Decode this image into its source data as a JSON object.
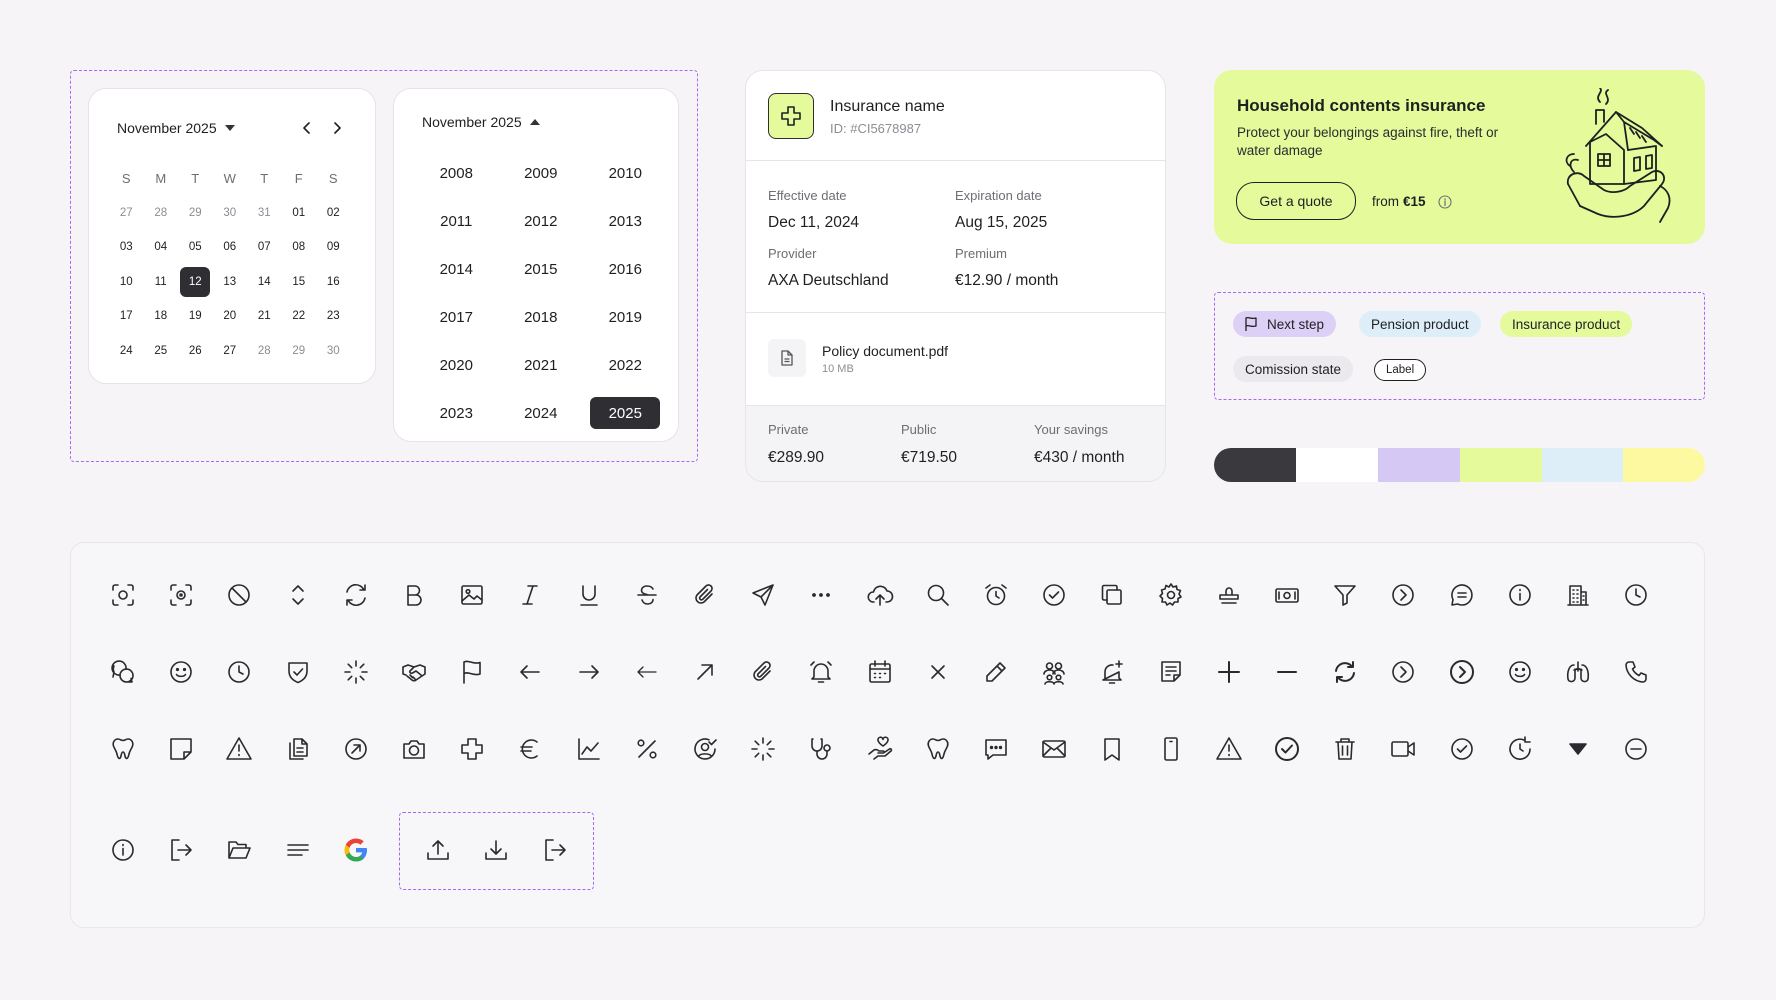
{
  "calendar": {
    "month_label": "November 2025",
    "weekdays": [
      "S",
      "M",
      "T",
      "W",
      "T",
      "F",
      "S"
    ],
    "days": [
      {
        "d": "27",
        "m": 1
      },
      {
        "d": "28",
        "m": 1
      },
      {
        "d": "29",
        "m": 1
      },
      {
        "d": "30",
        "m": 1
      },
      {
        "d": "31",
        "m": 1
      },
      {
        "d": "01",
        "m": 0
      },
      {
        "d": "02",
        "m": 0
      },
      {
        "d": "03",
        "m": 0
      },
      {
        "d": "04",
        "m": 0
      },
      {
        "d": "05",
        "m": 0
      },
      {
        "d": "06",
        "m": 0
      },
      {
        "d": "07",
        "m": 0
      },
      {
        "d": "08",
        "m": 0
      },
      {
        "d": "09",
        "m": 0
      },
      {
        "d": "10",
        "m": 0
      },
      {
        "d": "11",
        "m": 0
      },
      {
        "d": "12",
        "m": 0,
        "s": 1
      },
      {
        "d": "13",
        "m": 0
      },
      {
        "d": "14",
        "m": 0
      },
      {
        "d": "15",
        "m": 0
      },
      {
        "d": "16",
        "m": 0
      },
      {
        "d": "17",
        "m": 0
      },
      {
        "d": "18",
        "m": 0
      },
      {
        "d": "19",
        "m": 0
      },
      {
        "d": "20",
        "m": 0
      },
      {
        "d": "21",
        "m": 0
      },
      {
        "d": "22",
        "m": 0
      },
      {
        "d": "23",
        "m": 0
      },
      {
        "d": "24",
        "m": 0
      },
      {
        "d": "25",
        "m": 0
      },
      {
        "d": "26",
        "m": 0
      },
      {
        "d": "27",
        "m": 0
      },
      {
        "d": "28",
        "m": 1
      },
      {
        "d": "29",
        "m": 1
      },
      {
        "d": "30",
        "m": 1
      }
    ]
  },
  "year_picker": {
    "month_label": "November 2025",
    "years": [
      "2008",
      "2009",
      "2010",
      "2011",
      "2012",
      "2013",
      "2014",
      "2015",
      "2016",
      "2017",
      "2018",
      "2019",
      "2020",
      "2021",
      "2022",
      "2023",
      "2024",
      "2025"
    ],
    "selected": "2025"
  },
  "insurance": {
    "name": "Insurance name",
    "id": "ID: #CI5678987",
    "effective_label": "Effective date",
    "effective_value": "Dec 11, 2024",
    "expiration_label": "Expiration date",
    "expiration_value": "Aug 15, 2025",
    "provider_label": "Provider",
    "provider_value": "AXA Deutschland",
    "premium_label": "Premium",
    "premium_value": "€12.90 / month",
    "doc_name": "Policy document.pdf",
    "doc_size": "10 MB",
    "private_label": "Private",
    "private_value": "€289.90",
    "public_label": "Public",
    "public_value": "€719.50",
    "savings_label": "Your savings",
    "savings_value": "€430 / month"
  },
  "promo": {
    "title": "Household contents insurance",
    "description": "Protect your belongings against fire, theft or water damage",
    "cta": "Get a quote",
    "from_label": "from",
    "from_price": "€15"
  },
  "chips": {
    "next_step": "Next step",
    "pension": "Pension product",
    "insurance": "Insurance product",
    "commission": "Comission state",
    "label": "Label"
  },
  "colors": {
    "dark": "#3a393d",
    "white": "#ffffff",
    "lavender": "#d6c8f4",
    "lime": "#e4fa9b",
    "sky": "#ddeef8",
    "yellow": "#fdf9a1",
    "accent": "#a46bf2"
  },
  "icons": [
    [
      "scan-face-icon",
      "scan-icon",
      "block-icon",
      "chevron-up-down-icon",
      "refresh-icon",
      "bold-icon",
      "image-icon",
      "italic-icon",
      "underline-icon",
      "strikethrough-icon",
      "paperclip-icon",
      "send-icon",
      "more-horizontal-icon",
      "cloud-upload-icon",
      "search-icon",
      "alarm-icon",
      "check-circle-icon",
      "copy-icon",
      "gear-icon",
      "stamp-icon",
      "banknote-icon",
      "filter-icon",
      "chevron-right-circle-icon",
      "chat-icon",
      "info-icon",
      "building-icon",
      "clock-icon"
    ],
    [
      "chats-icon",
      "smile-icon",
      "clock-icon",
      "shield-check-icon",
      "loader-icon",
      "handshake-icon",
      "flag-icon",
      "arrow-left-icon",
      "arrow-right-icon",
      "arrow-left-thin-icon",
      "arrow-up-right-icon",
      "paperclip-icon",
      "bell-ring-icon",
      "calendar-icon",
      "close-icon",
      "pencil-icon",
      "users-icon",
      "bell-plus-icon",
      "note-icon",
      "plus-icon",
      "minus-icon",
      "sync-icon",
      "chevron-right-circle-icon",
      "chevron-right-circle-bold-icon",
      "smile-icon",
      "lungs-icon",
      "phone-icon"
    ],
    [
      "tooth-icon",
      "sticky-note-icon",
      "warning-icon",
      "documents-icon",
      "arrow-up-right-circle-icon",
      "camera-icon",
      "medical-cross-icon",
      "euro-icon",
      "chart-line-icon",
      "percent-icon",
      "user-check-icon",
      "loader-icon",
      "stethoscope-icon",
      "hand-heart-icon",
      "tooth-icon",
      "chat-dots-icon",
      "mail-icon",
      "bookmark-icon",
      "smartphone-icon",
      "warning-icon",
      "check-circle-bold-icon",
      "trash-icon",
      "video-icon",
      "check-circle-icon",
      "rotate-icon",
      "caret-down-icon",
      "minus-circle-icon"
    ],
    [
      "info-icon",
      "logout-icon",
      "folder-open-icon",
      "menu-lines-icon",
      "google-icon"
    ],
    [
      "upload-icon",
      "download-icon",
      "logout-icon"
    ]
  ]
}
